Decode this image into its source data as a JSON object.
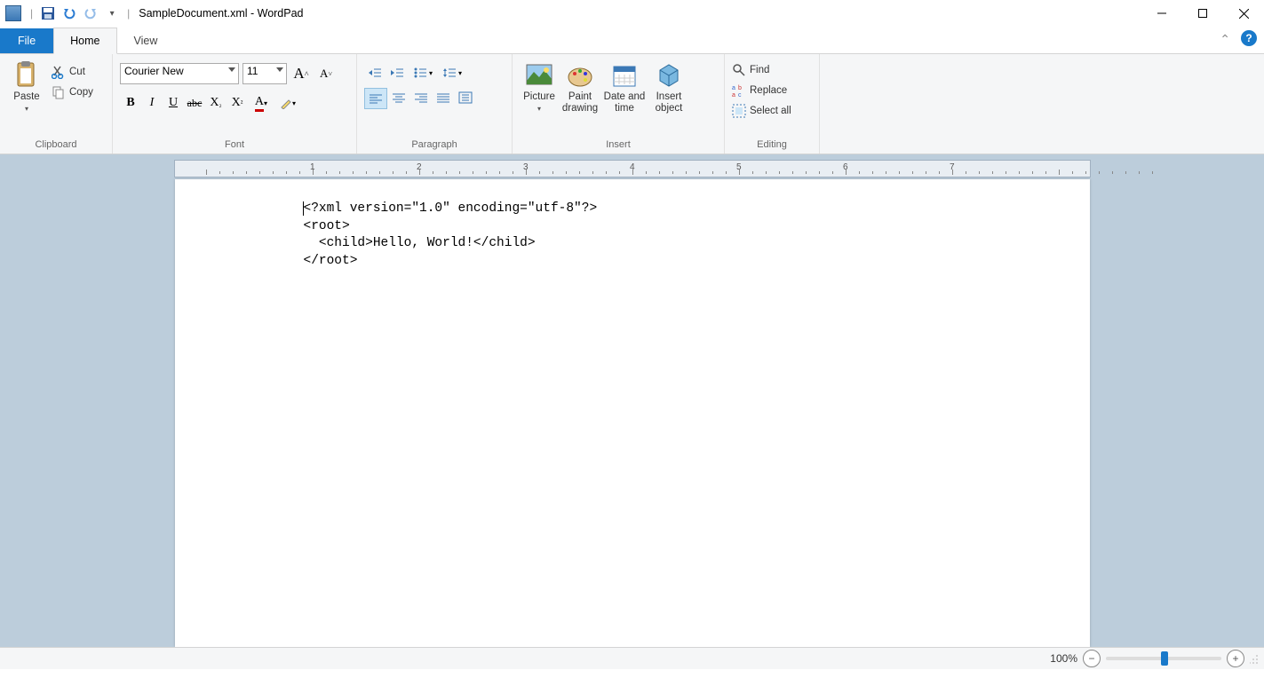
{
  "title": "SampleDocument.xml - WordPad",
  "tabs": {
    "file": "File",
    "home": "Home",
    "view": "View"
  },
  "clipboard": {
    "paste": "Paste",
    "cut": "Cut",
    "copy": "Copy",
    "label": "Clipboard"
  },
  "font": {
    "name": "Courier New",
    "size": "11",
    "label": "Font"
  },
  "paragraph": {
    "label": "Paragraph"
  },
  "insert": {
    "picture": "Picture",
    "paint": "Paint\ndrawing",
    "date": "Date and\ntime",
    "object": "Insert\nobject",
    "label": "Insert"
  },
  "editing": {
    "find": "Find",
    "replace": "Replace",
    "select": "Select all",
    "label": "Editing"
  },
  "ruler_numbers": [
    "1",
    "2",
    "3",
    "4",
    "5",
    "6",
    "7"
  ],
  "document_lines": [
    "<?xml version=\"1.0\" encoding=\"utf-8\"?>",
    "<root>",
    "  <child>Hello, World!</child>",
    "</root>"
  ],
  "zoom": "100%"
}
